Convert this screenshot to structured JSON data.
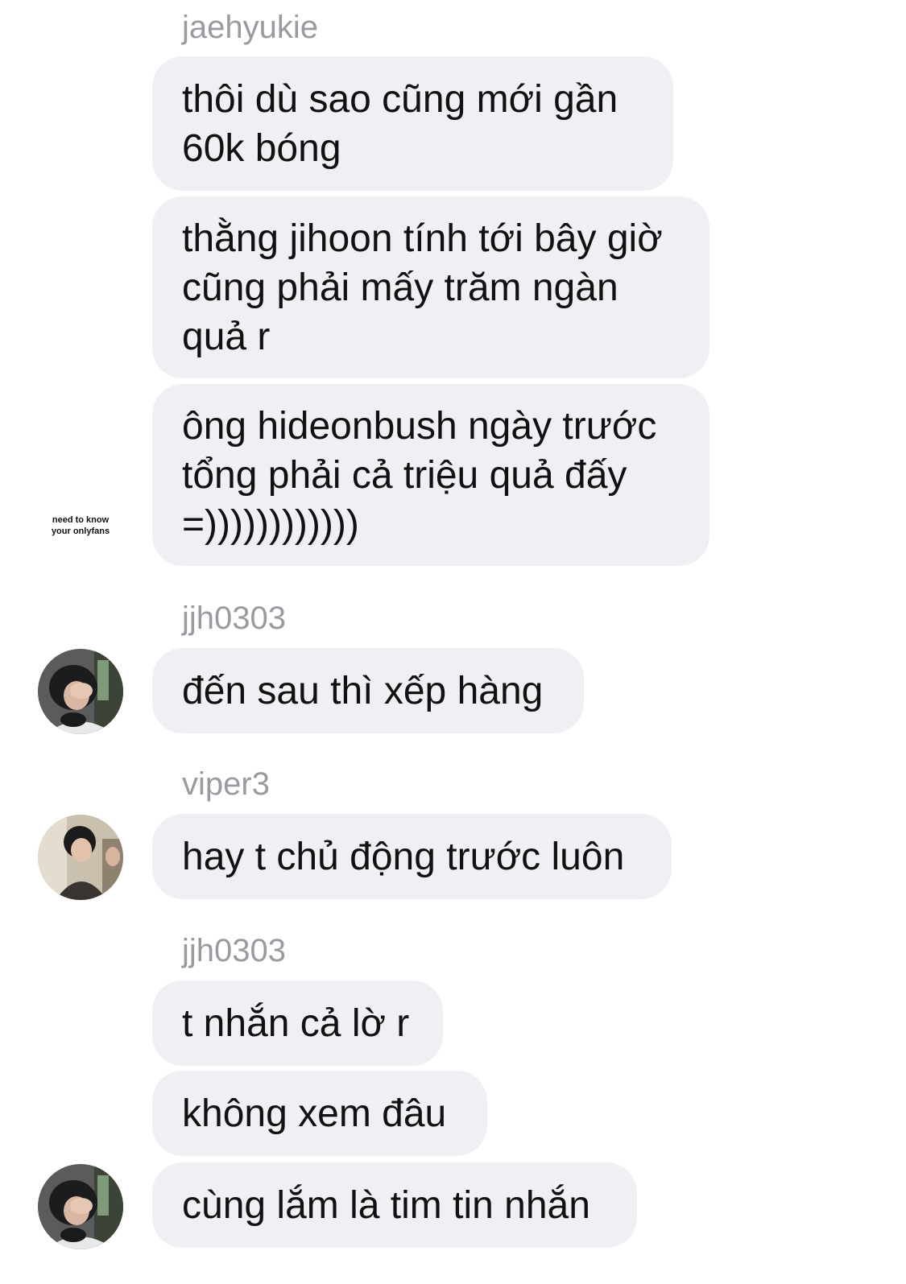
{
  "messages": {
    "group1": {
      "sender": "jaehyukie",
      "avatar_label": "need to know\nyour onlyfans",
      "bubbles": [
        "thôi dù sao cũng mới gần\n60k bóng",
        "thằng jihoon tính tới bây giờ\ncũng phải mấy trăm ngàn\nquả r",
        "ông hideonbush ngày trước\ntổng phải cả triệu quả đấy\n=))))))))))))"
      ]
    },
    "group2": {
      "sender": "jjh0303",
      "avatar": "user-photo-avatar",
      "bubbles": [
        "đến sau thì xếp hàng"
      ]
    },
    "group3": {
      "sender": "viper3",
      "avatar": "user-photo-avatar",
      "bubbles": [
        "hay t chủ động trước luôn"
      ]
    },
    "group4": {
      "sender": "jjh0303",
      "avatar": "user-photo-avatar",
      "bubbles": [
        "t nhắn cả lờ r",
        "không xem đâu",
        "cùng lắm là tim tin nhắn"
      ]
    }
  },
  "colors": {
    "bubble_background": "#efeff4",
    "sender_name": "#9a9aa0",
    "message_text": "#111111",
    "background": "#ffffff"
  }
}
